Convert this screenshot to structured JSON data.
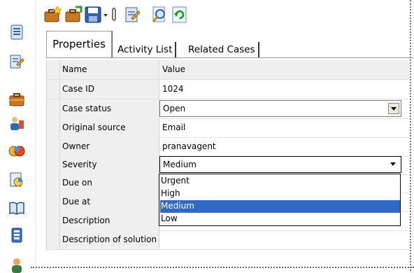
{
  "rail": {
    "icons": [
      "document-icon",
      "edit-document-icon",
      "briefcase-icon",
      "people-icon",
      "group-icon",
      "chart-icon",
      "book-icon",
      "form-icon",
      "user-icon"
    ]
  },
  "toolbar": {
    "buttons": [
      "new-case-icon",
      "new-subcase-icon",
      "save-icon",
      "attach-icon",
      "edit-icon",
      "search-icon",
      "refresh-icon"
    ]
  },
  "tabs": {
    "active": "Properties",
    "items": [
      "Activity List",
      "Related Cases"
    ]
  },
  "grid": {
    "header": {
      "name": "Name",
      "value": "Value"
    },
    "rows": [
      {
        "name": "Case ID",
        "value": "1024"
      },
      {
        "name": "Case status",
        "value": "Open"
      },
      {
        "name": "Original source",
        "value": "Email"
      },
      {
        "name": "Owner",
        "value": "pranavagent"
      },
      {
        "name": "Severity",
        "value": "Medium"
      },
      {
        "name": "Due on",
        "value": ""
      },
      {
        "name": "Due at",
        "value": ""
      },
      {
        "name": "Description",
        "value": ""
      },
      {
        "name": "Description of solution",
        "value": ""
      }
    ]
  },
  "severity_dropdown": {
    "options": [
      "Urgent",
      "High",
      "Medium",
      "Low"
    ],
    "selected": "Medium"
  },
  "colors": {
    "selection": "#316ac5",
    "name_column": "#efefef"
  }
}
